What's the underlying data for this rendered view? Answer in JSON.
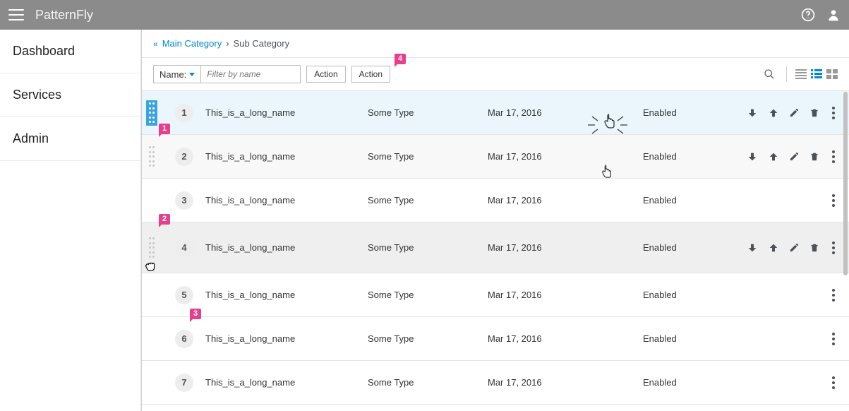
{
  "header": {
    "brand": "PatternFly"
  },
  "sidebar": {
    "items": [
      {
        "label": "Dashboard"
      },
      {
        "label": "Services"
      },
      {
        "label": "Admin"
      }
    ]
  },
  "breadcrumb": {
    "main": "Main Category",
    "sub": "Sub Category"
  },
  "toolbar": {
    "filter_label": "Name:",
    "filter_placeholder": "Filter by name",
    "action1": "Action",
    "action2": "Action"
  },
  "rows": [
    {
      "num": "1",
      "name": "This_is_a_long_name",
      "type": "Some Type",
      "date": "Mar 17, 2016",
      "status": "Enabled"
    },
    {
      "num": "2",
      "name": "This_is_a_long_name",
      "type": "Some Type",
      "date": "Mar 17, 2016",
      "status": "Enabled"
    },
    {
      "num": "3",
      "name": "This_is_a_long_name",
      "type": "Some Type",
      "date": "Mar 17, 2016",
      "status": "Enabled"
    },
    {
      "num": "4",
      "name": "This_is_a_long_name",
      "type": "Some Type",
      "date": "Mar 17, 2016",
      "status": "Enabled"
    },
    {
      "num": "5",
      "name": "This_is_a_long_name",
      "type": "Some Type",
      "date": "Mar 17, 2016",
      "status": "Enabled"
    },
    {
      "num": "6",
      "name": "This_is_a_long_name",
      "type": "Some Type",
      "date": "Mar 17, 2016",
      "status": "Enabled"
    },
    {
      "num": "7",
      "name": "This_is_a_long_name",
      "type": "Some Type",
      "date": "Mar 17, 2016",
      "status": "Enabled"
    }
  ],
  "annotations": {
    "pin1": "1",
    "pin2": "2",
    "pin3": "3",
    "pin4": "4"
  }
}
